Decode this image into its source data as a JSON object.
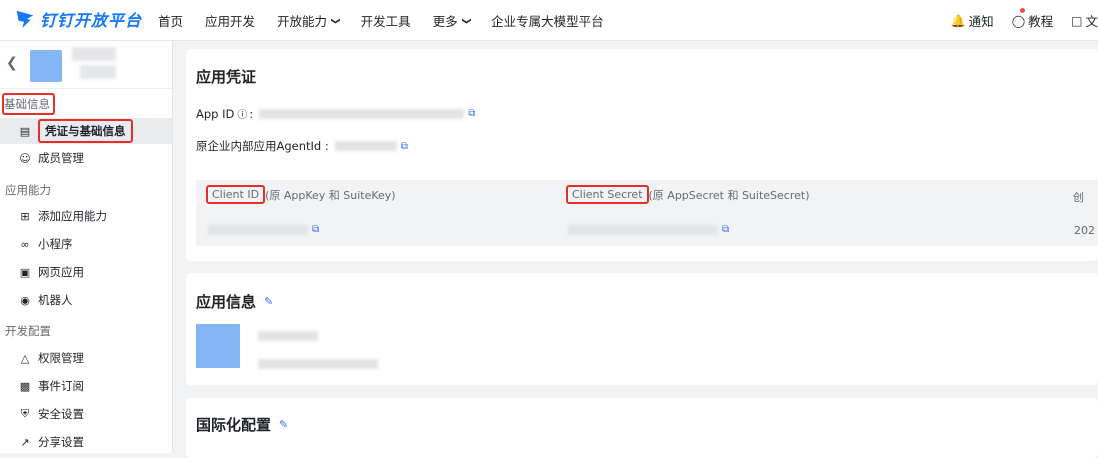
{
  "header": {
    "logo_text": "钉钉开放平台",
    "nav": [
      {
        "label": "首页",
        "dropdown": false
      },
      {
        "label": "应用开发",
        "dropdown": false
      },
      {
        "label": "开放能力",
        "dropdown": true
      },
      {
        "label": "开发工具",
        "dropdown": false
      },
      {
        "label": "更多",
        "dropdown": true
      },
      {
        "label": "企业专属大模型平台",
        "dropdown": false
      }
    ],
    "right": {
      "notify": "通知",
      "tutorial": "教程",
      "docs": "文"
    }
  },
  "sidebar": {
    "sections": [
      {
        "title": "基础信息",
        "items": [
          "凭证与基础信息",
          "成员管理"
        ]
      },
      {
        "title": "应用能力",
        "items": [
          "添加应用能力",
          "小程序",
          "网页应用",
          "机器人"
        ]
      },
      {
        "title": "开发配置",
        "items": [
          "权限管理",
          "事件订阅",
          "安全设置",
          "分享设置"
        ]
      }
    ]
  },
  "credentials": {
    "title": "应用凭证",
    "app_id_label": "App ID",
    "agent_id_label": "原企业内部应用AgentId :",
    "client_id_label": "Client ID",
    "client_id_note": "(原 AppKey 和 SuiteKey)",
    "client_secret_label": "Client Secret",
    "client_secret_note": "(原 AppSecret 和 SuiteSecret)",
    "trunc_head": "创",
    "trunc_val": "202"
  },
  "app_info": {
    "title": "应用信息"
  },
  "i18n": {
    "title": "国际化配置"
  },
  "colors": {
    "brand": "#1677ff",
    "highlight": "#e5302a",
    "link": "#3370ff"
  }
}
